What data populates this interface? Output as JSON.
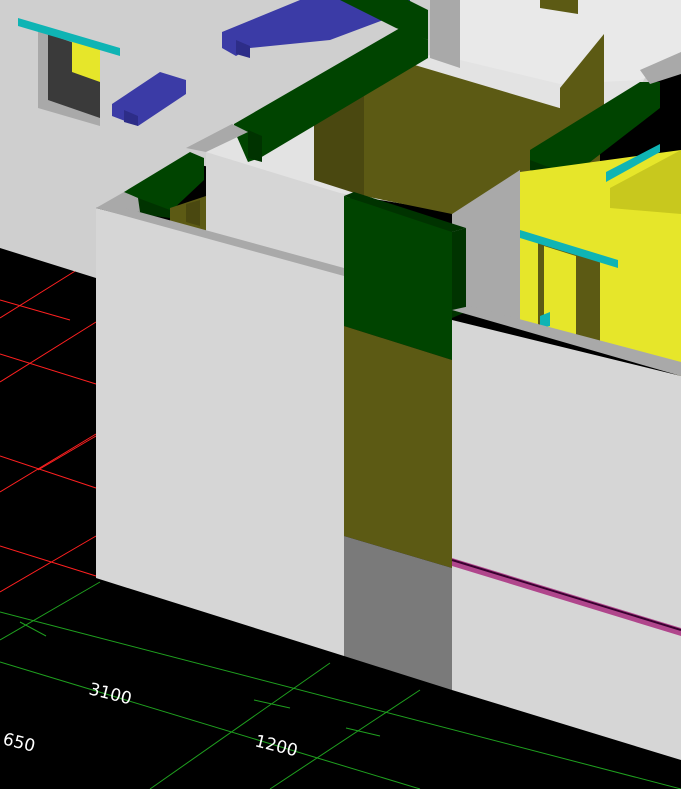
{
  "viewport": {
    "background": "#000000",
    "colors": {
      "wall_top": "#cfcfcf",
      "wall_side": "#a9a9a9",
      "wall_face": "#d6d6d6",
      "beam_green": "#004400",
      "column_olive": "#5c5a14",
      "column_olive_dark": "#4a4810",
      "column_base": "#7a7a7a",
      "door_yellow": "#e6e62a",
      "door_yellow_dark": "#c8c81e",
      "accent_cyan": "#0fb4b4",
      "furniture_blue": "#3b3ba6",
      "window_dark": "#3a3a3a",
      "grid_red": "#ff2020",
      "grid_green": "#1fa01f",
      "pipe_magenta": "#b0468c"
    }
  },
  "dimensions": [
    {
      "text": "3100"
    },
    {
      "text": "1200"
    },
    {
      "text": "650"
    }
  ]
}
